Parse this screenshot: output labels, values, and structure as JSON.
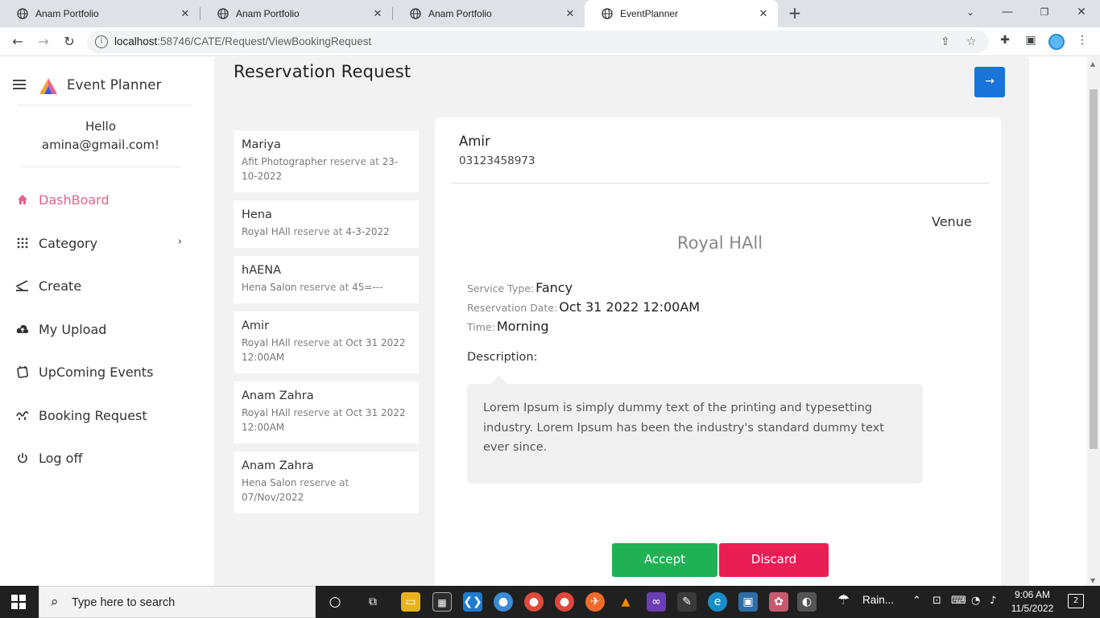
{
  "browser": {
    "tabs": [
      {
        "title": "Anam Portfolio",
        "active": false
      },
      {
        "title": "Anam Portfolio",
        "active": false
      },
      {
        "title": "Anam Portfolio",
        "active": false
      },
      {
        "title": "EventPlanner",
        "active": true
      }
    ],
    "url_host": "localhost",
    "url_rest": ":58746/CATE/Request/ViewBookingRequest"
  },
  "sidebar": {
    "brand": "Event Planner",
    "greeting_line1": "Hello",
    "greeting_line2": "amina@gmail.com!",
    "items": [
      {
        "label": "DashBoard",
        "icon": "home-icon",
        "active": true
      },
      {
        "label": "Category",
        "icon": "grid-dots-icon",
        "active": false
      },
      {
        "label": "Create",
        "icon": "create-icon",
        "active": false
      },
      {
        "label": "My Upload",
        "icon": "upload-icon",
        "active": false
      },
      {
        "label": "UpComing Events",
        "icon": "calendar-icon",
        "active": false
      },
      {
        "label": "Booking Request",
        "icon": "booking-icon",
        "active": false
      },
      {
        "label": "Log off",
        "icon": "power-icon",
        "active": false
      }
    ]
  },
  "main": {
    "title": "Reservation Request",
    "requests": [
      {
        "name": "Mariya",
        "item": "Afit Photographer",
        "joiner": "reserve at",
        "date": "23-10-2022"
      },
      {
        "name": "Hena",
        "item": "Royal HAll",
        "joiner": "reserve at",
        "date": "4-3-2022"
      },
      {
        "name": "hAENA",
        "item": "Hena Salon",
        "joiner": "reserve at",
        "date": "45=---"
      },
      {
        "name": "Amir",
        "item": "Royal HAll",
        "joiner": "reserve at",
        "date": "Oct 31 2022 12:00AM"
      },
      {
        "name": "Anam Zahra",
        "item": "Royal HAll",
        "joiner": "reserve at",
        "date": "Oct 31 2022 12:00AM"
      },
      {
        "name": "Anam Zahra",
        "item": "Hena Salon",
        "joiner": "reserve at",
        "date": "07/Nov/2022"
      }
    ],
    "detail": {
      "name": "Amir",
      "phone": "03123458973",
      "category_tag": "Venue",
      "venue_name": "Royal HAll",
      "service_type_label": "Service Type:",
      "service_type": "Fancy",
      "reservation_date_label": "Reservation Date:",
      "reservation_date": "Oct 31 2022 12:00AM",
      "time_label": "Time:",
      "time": "Morning",
      "description_label": "Description:",
      "description": "Lorem Ipsum is simply dummy text of the printing and typesetting industry. Lorem Ipsum has been the industry's standard dummy text ever since.",
      "accept_label": "Accept",
      "discard_label": "Discard"
    }
  },
  "taskbar": {
    "search_placeholder": "Type here to search",
    "weather": "Rain...",
    "time": "9:06 AM",
    "date": "11/5/2022",
    "notifications": "2"
  },
  "colors": {
    "accent_blue": "#1874d8",
    "accept_green": "#20b154",
    "discard_red": "#eb1d55",
    "active_pink": "#e4628d"
  }
}
